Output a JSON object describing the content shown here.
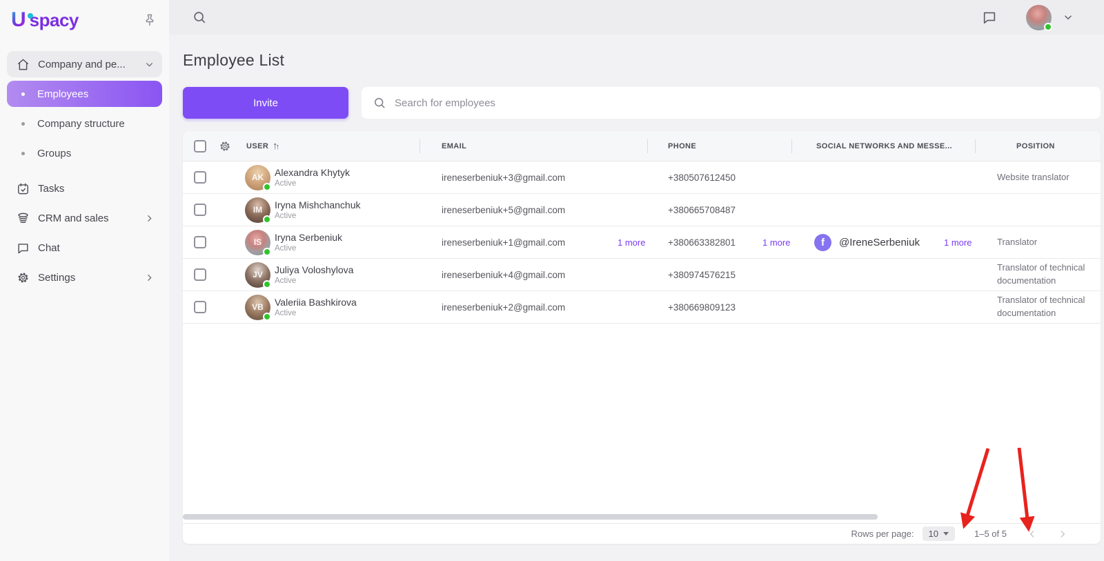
{
  "brand": {
    "logo_letter": "U",
    "logo_text": "spacy"
  },
  "icons": {
    "sidebar_pin": "pushpin",
    "topbar_search": "magnifier",
    "topbar_messenger": "speech-bubble",
    "sidebar_home": "home",
    "sidebar_tasks": "calendar-check",
    "sidebar_crm": "database",
    "sidebar_chat": "speech-bubble",
    "sidebar_settings": "gear",
    "table_column_settings": "gear",
    "user_sort": "two-up-arrows",
    "social_facebook": "f-in-circle",
    "pagination_prev": "chevron-left",
    "pagination_next": "chevron-right"
  },
  "sidebar": {
    "group_label": "Company and pe...",
    "sub_items": [
      {
        "label": "Employees",
        "active": true
      },
      {
        "label": "Company structure",
        "active": false
      },
      {
        "label": "Groups",
        "active": false
      }
    ],
    "items": [
      {
        "label": "Tasks",
        "has_chevron": false
      },
      {
        "label": "CRM and sales",
        "has_chevron": true
      },
      {
        "label": "Chat",
        "has_chevron": false
      },
      {
        "label": "Settings",
        "has_chevron": true
      }
    ]
  },
  "page": {
    "title": "Employee List",
    "invite_button": "Invite",
    "search_placeholder": "Search for employees"
  },
  "table": {
    "columns": {
      "user": "USER",
      "email": "EMAIL",
      "phone": "PHONE",
      "social": "SOCIAL NETWORKS AND MESSE...",
      "position": "POSITION"
    },
    "rows": [
      {
        "avatar_initials": "AK",
        "name": "Alexandra Khytyk",
        "status": "Active",
        "email": "ireneserbeniuk+3@gmail.com",
        "phone": "+380507612450",
        "position": "Website translator"
      },
      {
        "avatar_initials": "IM",
        "name": "Iryna Mishchanchuk",
        "status": "Active",
        "email": "ireneserbeniuk+5@gmail.com",
        "phone": "+380665708487",
        "position": ""
      },
      {
        "avatar_initials": "IS",
        "name": "Iryna Serbeniuk",
        "status": "Active",
        "email": "ireneserbeniuk+1@gmail.com",
        "email_more": "1 more",
        "phone": "+380663382801",
        "phone_more": "1 more",
        "social_handle": "@IreneSerbeniuk",
        "social_more": "1 more",
        "position": "Translator"
      },
      {
        "avatar_initials": "JV",
        "name": "Juliya Voloshylova",
        "status": "Active",
        "email": "ireneserbeniuk+4@gmail.com",
        "phone": "+380974576215",
        "position": "Translator of technical documentation"
      },
      {
        "avatar_initials": "VB",
        "name": "Valeriia Bashkirova",
        "status": "Active",
        "email": "ireneserbeniuk+2@gmail.com",
        "phone": "+380669809123",
        "position": "Translator of technical documentation"
      }
    ]
  },
  "pagination": {
    "rows_per_page_label": "Rows per page:",
    "rows_per_page_value": "10",
    "range": "1–5 of 5"
  },
  "annotations": {
    "type": "red-arrows",
    "count": 2
  },
  "colors": {
    "accent_purple": "#7e4cf5",
    "active_gradient_start": "#b28bf0",
    "active_gradient_end": "#8a55f2",
    "link_purple": "#7a3bf5",
    "status_green": "#31c42d",
    "annotation_red": "#e8231d",
    "facebook_badge": "#8673f0"
  }
}
